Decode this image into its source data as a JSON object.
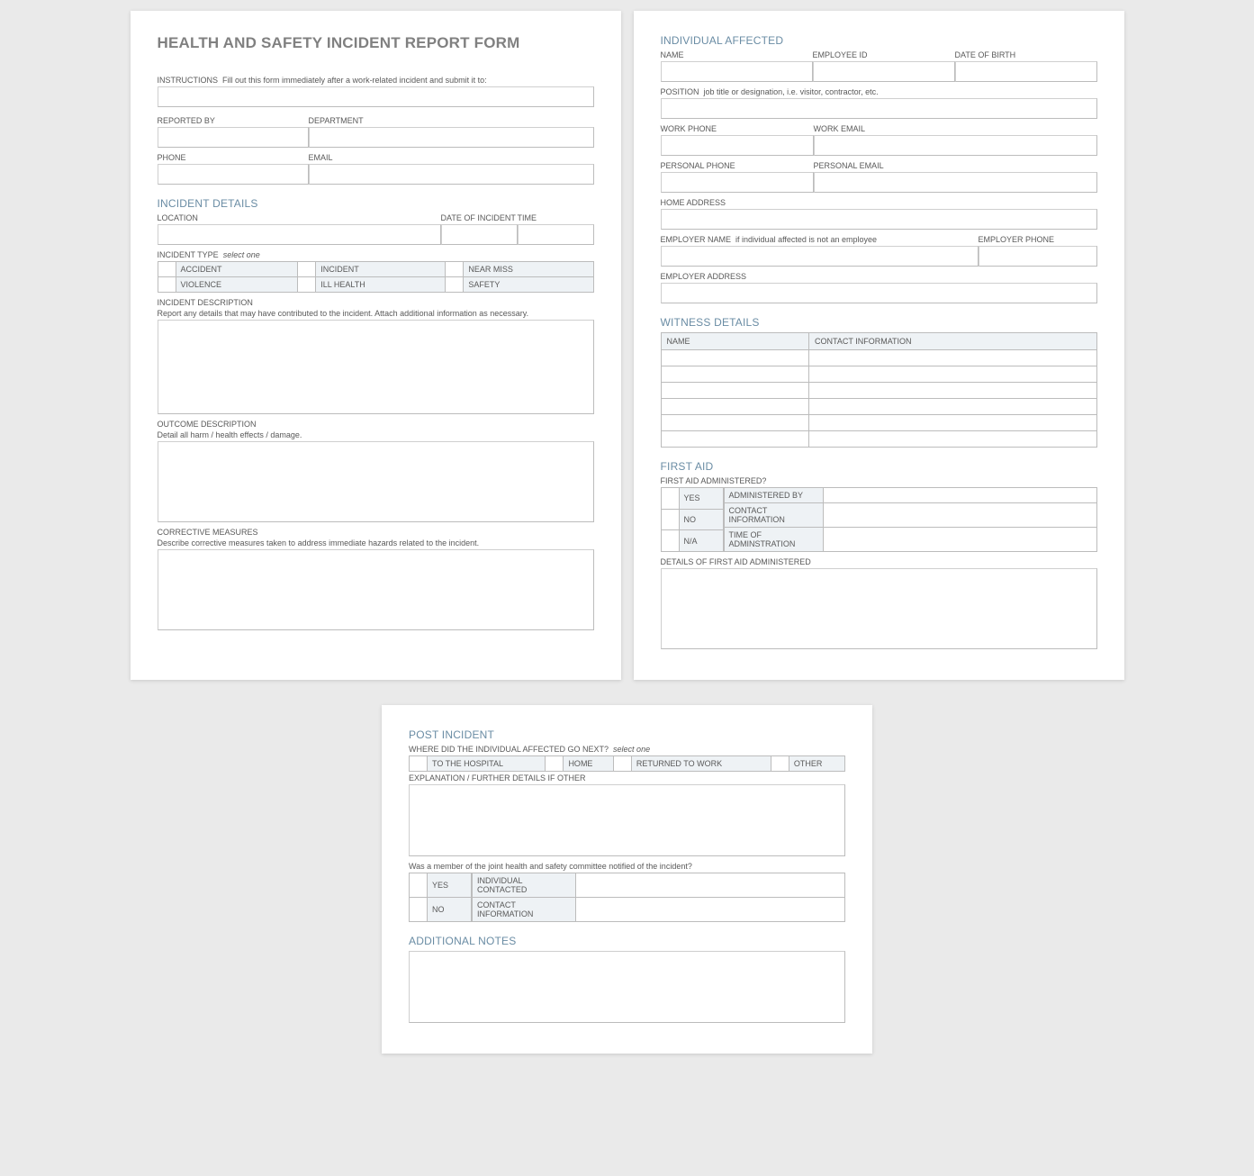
{
  "form": {
    "title": "HEALTH AND SAFETY INCIDENT REPORT FORM",
    "instructions_label": "INSTRUCTIONS",
    "instructions_hint": "Fill out this form immediately after a work-related incident and submit it to:",
    "reported_by_label": "REPORTED BY",
    "department_label": "DEPARTMENT",
    "phone_label": "PHONE",
    "email_label": "EMAIL"
  },
  "incident": {
    "section": "INCIDENT DETAILS",
    "location_label": "LOCATION",
    "date_label": "DATE OF INCIDENT",
    "time_label": "TIME",
    "type_label": "INCIDENT TYPE",
    "select_one": "select one",
    "types": [
      "ACCIDENT",
      "INCIDENT",
      "NEAR MISS",
      "VIOLENCE",
      "ILL HEALTH",
      "SAFETY"
    ],
    "desc_label": "INCIDENT DESCRIPTION",
    "desc_hint": "Report any details that may have contributed to the incident.  Attach additional information as necessary.",
    "outcome_label": "OUTCOME DESCRIPTION",
    "outcome_hint": "Detail all harm / health effects / damage.",
    "corrective_label": "CORRECTIVE MEASURES",
    "corrective_hint": "Describe corrective measures taken to address immediate hazards related to the incident."
  },
  "individual": {
    "section": "INDIVIDUAL AFFECTED",
    "name_label": "NAME",
    "employee_id_label": "EMPLOYEE ID",
    "dob_label": "DATE OF BIRTH",
    "position_label": "POSITION",
    "position_hint": "job title or designation, i.e. visitor, contractor, etc.",
    "work_phone_label": "WORK PHONE",
    "work_email_label": "WORK EMAIL",
    "personal_phone_label": "PERSONAL PHONE",
    "personal_email_label": "PERSONAL EMAIL",
    "home_address_label": "HOME ADDRESS",
    "employer_name_label": "EMPLOYER NAME",
    "employer_name_hint": "if individual affected is not an employee",
    "employer_phone_label": "EMPLOYER PHONE",
    "employer_address_label": "EMPLOYER ADDRESS"
  },
  "witness": {
    "section": "WITNESS DETAILS",
    "name_col": "NAME",
    "contact_col": "CONTACT INFORMATION",
    "rows": 6
  },
  "firstaid": {
    "section": "FIRST AID",
    "administered_q": "FIRST AID ADMINISTERED?",
    "yes": "YES",
    "no": "NO",
    "na": "N/A",
    "admin_by": "ADMINISTERED BY",
    "contact": "CONTACT INFORMATION",
    "time": "TIME OF ADMINSTRATION",
    "details_label": "DETAILS OF FIRST AID ADMINISTERED"
  },
  "post": {
    "section": "POST INCIDENT",
    "where_q": "WHERE DID THE INDIVIDUAL AFFECTED GO NEXT?",
    "select_one": "select one",
    "options": [
      "TO THE HOSPITAL",
      "HOME",
      "RETURNED TO WORK",
      "OTHER"
    ],
    "explanation_label": "EXPLANATION / FURTHER DETAILS IF OTHER",
    "committee_q": "Was a member of the joint health and safety committee notified of the incident?",
    "yes": "YES",
    "no": "NO",
    "contacted": "INDIVIDUAL CONTACTED",
    "contact_info": "CONTACT INFORMATION"
  },
  "notes": {
    "section": "ADDITIONAL NOTES"
  }
}
